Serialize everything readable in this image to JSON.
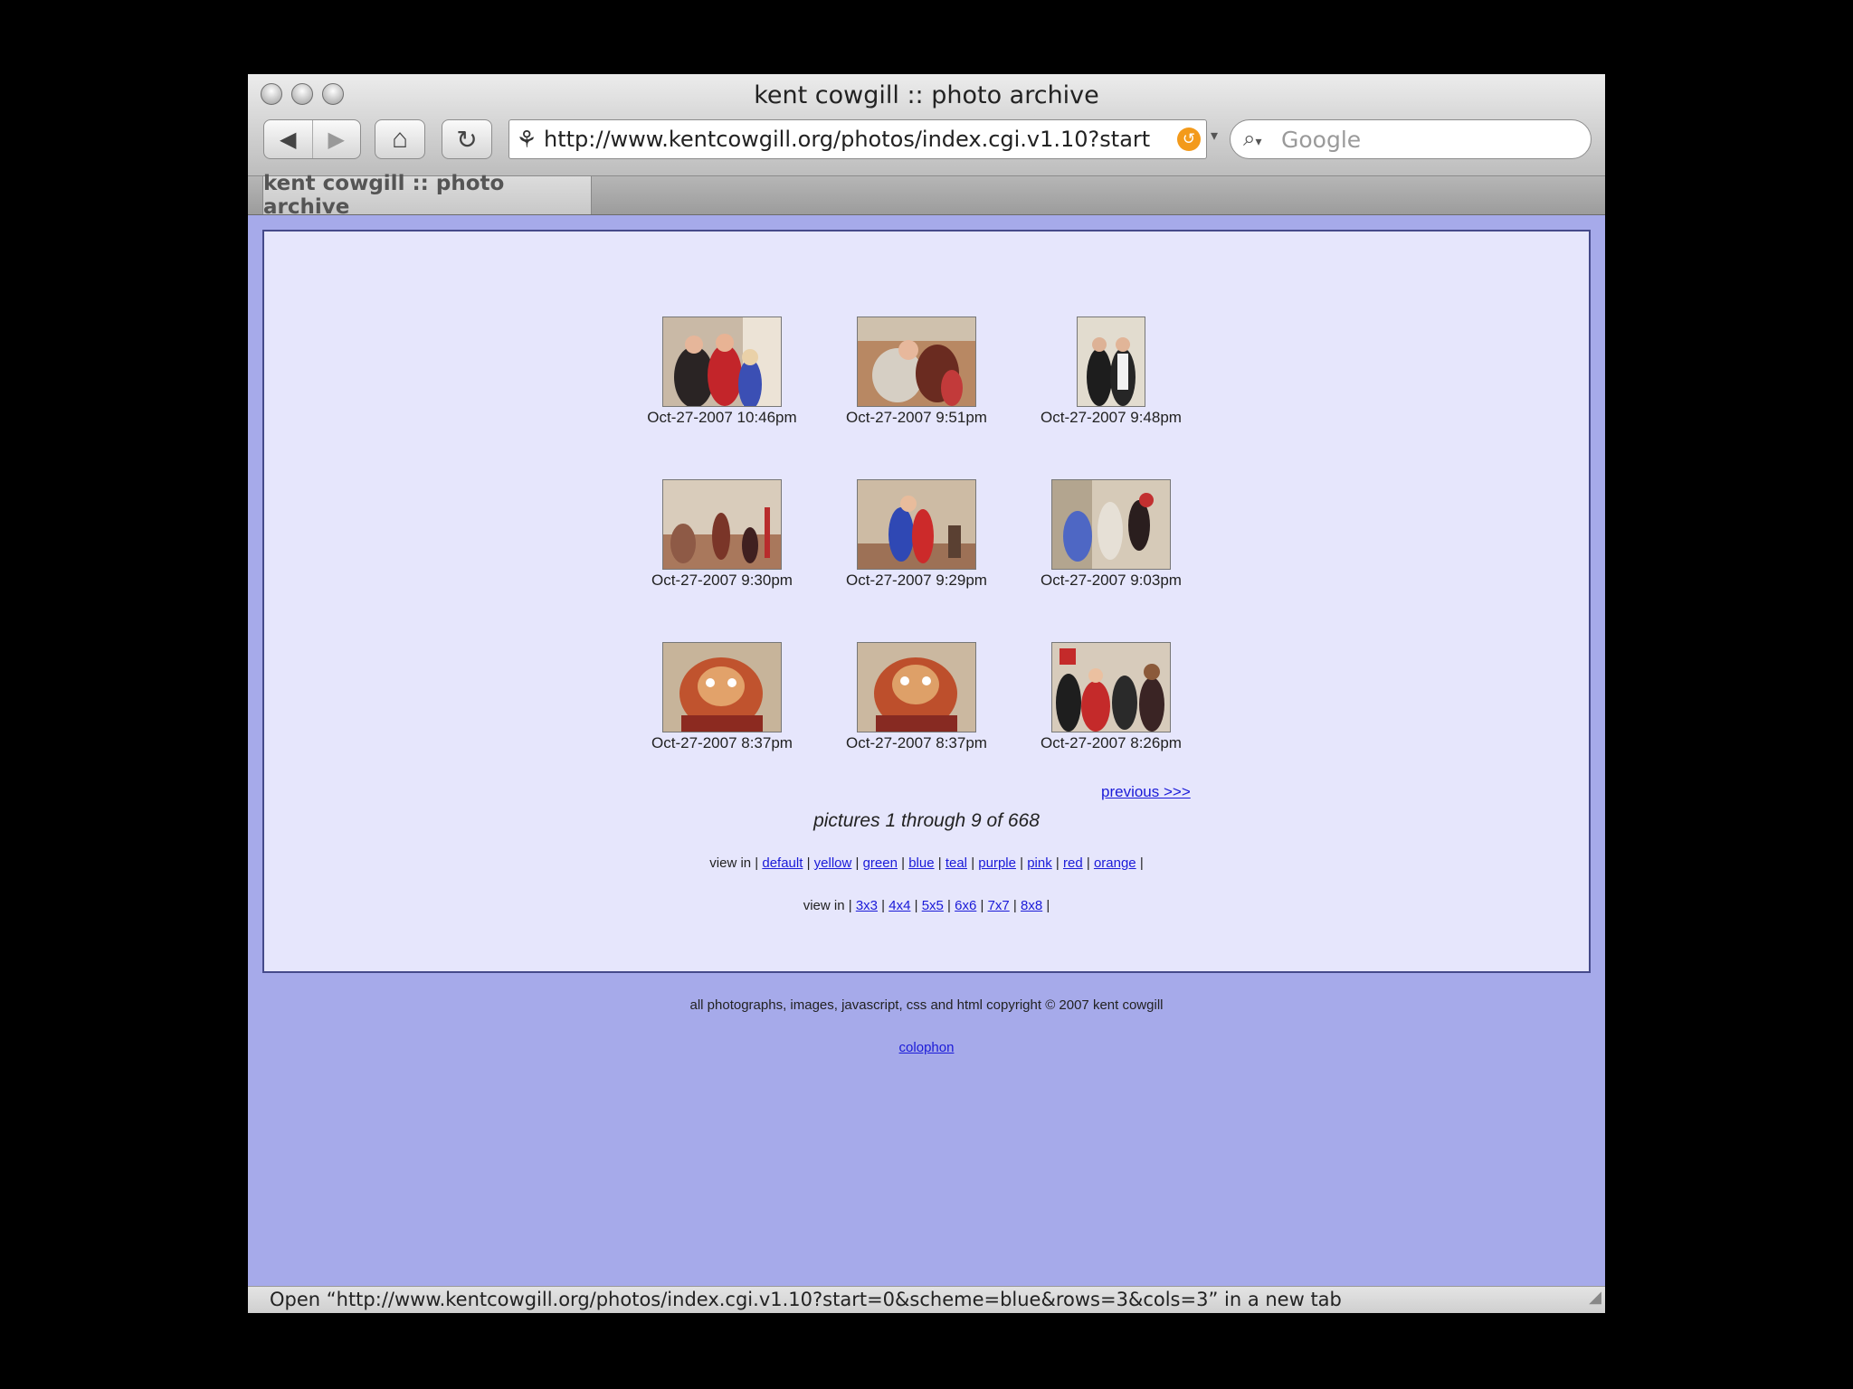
{
  "window": {
    "title": "kent cowgill :: photo archive",
    "address": "http://www.kentcowgill.org/photos/index.cgi.v1.10?start",
    "search_placeholder": "Google",
    "tab_label": "kent cowgill :: photo archive",
    "status": "Open “http://www.kentcowgill.org/photos/index.cgi.v1.10?start=0&scheme=blue&rows=3&cols=3” in a new tab"
  },
  "icons": {
    "back": "◀",
    "forward": "▶",
    "home": "⌂",
    "reload": "↻",
    "favicon": "⚘",
    "snapback": "↺",
    "search": "⌕",
    "dropdown": "▾",
    "grip": "◢"
  },
  "photos": [
    {
      "caption": "Oct-27-2007 10:46pm"
    },
    {
      "caption": "Oct-27-2007 9:51pm"
    },
    {
      "caption": "Oct-27-2007 9:48pm"
    },
    {
      "caption": "Oct-27-2007 9:30pm"
    },
    {
      "caption": "Oct-27-2007 9:29pm"
    },
    {
      "caption": "Oct-27-2007 9:03pm"
    },
    {
      "caption": "Oct-27-2007 8:37pm"
    },
    {
      "caption": "Oct-27-2007 8:37pm"
    },
    {
      "caption": "Oct-27-2007 8:26pm"
    }
  ],
  "pagination": {
    "previous": "previous >>>",
    "count": "pictures 1 through 9 of 668"
  },
  "schemes": {
    "prefix": "view in |",
    "sep": "|",
    "items": [
      "default",
      "yellow",
      "green",
      "blue",
      "teal",
      "purple",
      "pink",
      "red",
      "orange"
    ]
  },
  "grids": {
    "prefix": "view in |",
    "sep": "|",
    "items": [
      "3x3",
      "4x4",
      "5x5",
      "6x6",
      "7x7",
      "8x8"
    ]
  },
  "footer": {
    "copyright": "all photographs, images, javascript, css and html copyright © 2007 kent cowgill",
    "colophon": "colophon"
  },
  "colors": {
    "page_bg": "#a6aaea",
    "panel_bg": "#e6e6fc",
    "link": "#1a1ad8"
  }
}
